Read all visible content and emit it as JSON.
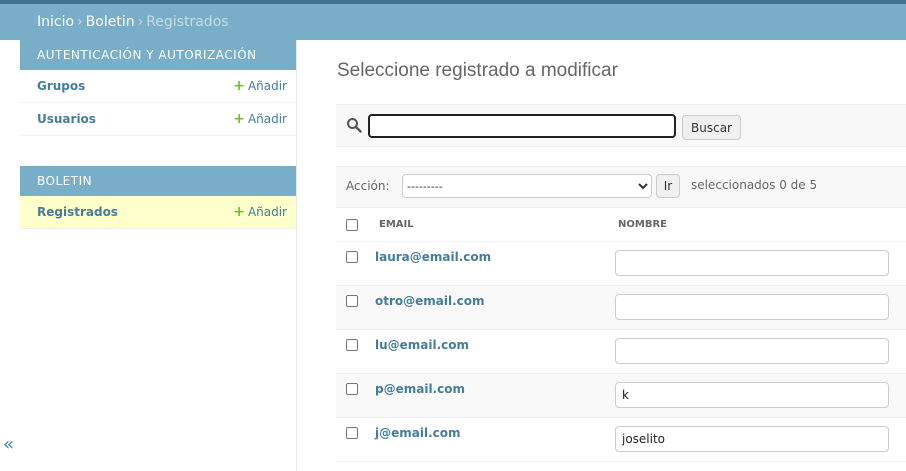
{
  "breadcrumbs": {
    "home": "Inicio",
    "app": "Boletin",
    "current": "Registrados",
    "separator": "›"
  },
  "sidebar": {
    "modules": [
      {
        "caption": "AUTENTICACIÓN Y AUTORIZACIÓN",
        "models": [
          {
            "name": "Grupos",
            "add": "Añadir"
          },
          {
            "name": "Usuarios",
            "add": "Añadir"
          }
        ]
      },
      {
        "caption": "BOLETIN",
        "models": [
          {
            "name": "Registrados",
            "add": "Añadir",
            "current": true
          }
        ]
      }
    ],
    "collapse_symbol": "«"
  },
  "main": {
    "title": "Seleccione registrado a modificar",
    "search": {
      "value": "",
      "button": "Buscar"
    },
    "actions": {
      "label": "Acción:",
      "selected": "---------",
      "go": "Ir",
      "counter": "seleccionados 0 de 5"
    },
    "table": {
      "headers": {
        "email": "EMAIL",
        "nombre": "NOMBRE"
      },
      "rows": [
        {
          "email": "laura@email.com",
          "nombre": ""
        },
        {
          "email": "otro@email.com",
          "nombre": ""
        },
        {
          "email": "lu@email.com",
          "nombre": ""
        },
        {
          "email": "p@email.com",
          "nombre": "k"
        },
        {
          "email": "j@email.com",
          "nombre": "joselito"
        }
      ]
    }
  },
  "icons": {
    "search": "search-icon",
    "add": "plus-icon",
    "collapse": "double-chevron-left-icon"
  },
  "colors": {
    "header": "#79aec8",
    "topbar": "#417690",
    "link": "#447e9b",
    "add_plus": "#70bf2b",
    "current_row": "#ffffcc"
  }
}
